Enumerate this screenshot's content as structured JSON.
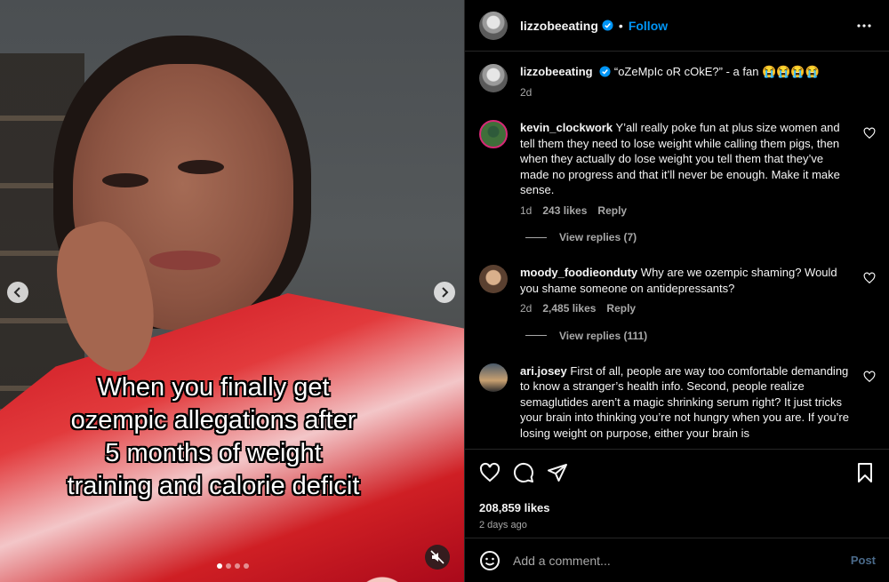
{
  "media": {
    "caption_lines": [
      "When you finally get",
      "ozempic allegations after",
      "5 months of weight",
      "training and calorie deficit"
    ],
    "slide_count": 4,
    "active_slide": 1
  },
  "header": {
    "username": "lizzobeeating",
    "separator": "•",
    "follow_label": "Follow"
  },
  "post_caption": {
    "username": "lizzobeeating",
    "text": "“oZeMpIc oR cOkE?” - a fan 😭😭😭😭",
    "age": "2d"
  },
  "comments": [
    {
      "username": "kevin_clockwork",
      "text": "Y’all really poke fun at plus size women and tell them they need to lose weight while calling them pigs, then when they actually do lose weight you tell them that they’ve made no progress and that it’ll never be enough. Make it make sense.",
      "age": "1d",
      "likes": "243 likes",
      "reply_label": "Reply",
      "view_replies": "View replies (7)"
    },
    {
      "username": "moody_foodieonduty",
      "text": "Why are we ozempic shaming? Would you shame someone on antidepressants?",
      "age": "2d",
      "likes": "2,485 likes",
      "reply_label": "Reply",
      "view_replies": "View replies (111)"
    },
    {
      "username": "ari.josey",
      "text": "First of all, people are way too comfortable demanding to know a stranger’s health info. Second, people realize semaglutides aren’t a magic shrinking serum right? It just tricks your brain into thinking you’re not hungry when you are. If you’re losing weight on purpose, either your brain is"
    }
  ],
  "actions": {
    "likes_count": "208,859 likes",
    "posted_ago": "2 days ago"
  },
  "add_comment": {
    "placeholder": "Add a comment...",
    "post_label": "Post"
  },
  "colors": {
    "accent": "#0095f6",
    "muted": "#a8a8a8",
    "panel_bg": "#000000",
    "divider": "#262626"
  },
  "icons": [
    "verified-badge-icon",
    "more-options-icon",
    "heart-icon",
    "comment-icon",
    "share-icon",
    "bookmark-icon",
    "emoji-icon",
    "chevron-left-icon",
    "chevron-right-icon",
    "muted-speaker-icon"
  ]
}
